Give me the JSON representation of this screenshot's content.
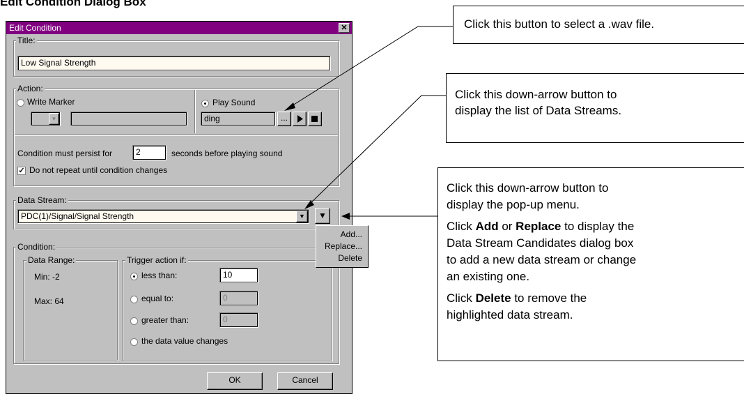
{
  "doc_heading": "Edit Condition Dialog Box",
  "dialog": {
    "title": "Edit Condition",
    "close_glyph": "✕",
    "title_group": {
      "label": "Title:",
      "value": "Low Signal Strength"
    },
    "action_group": {
      "label": "Action:",
      "write_marker_label": "Write Marker",
      "play_sound_label": "Play Sound",
      "sound_value": "ding",
      "browse_label": "...",
      "play_icon": "play-icon",
      "stop_icon": "stop-icon"
    },
    "persist_prefix": "Condition must persist for",
    "persist_value": "2",
    "persist_suffix": "seconds before playing sound",
    "repeat_label": "Do not repeat until condition changes",
    "repeat_checked": true,
    "data_stream_group": {
      "label": "Data Stream:",
      "value": "PDC(1)/Signal/Signal Strength"
    },
    "popup_menu": [
      "Add...",
      "Replace...",
      "Delete"
    ],
    "condition_group": {
      "label": "Condition:",
      "data_range_label": "Data Range:",
      "min_text": "Min: -2",
      "max_text": "Max: 64",
      "trigger_label": "Trigger action if:",
      "options": [
        {
          "label": "less than:",
          "value": "10",
          "selected": true
        },
        {
          "label": "equal to:",
          "value": "0",
          "selected": false
        },
        {
          "label": "greater than:",
          "value": "0",
          "selected": false
        },
        {
          "label": "the data value changes",
          "selected": false
        }
      ]
    },
    "ok_label": "OK",
    "cancel_label": "Cancel"
  },
  "callouts": {
    "wav": "Click this button to select a .wav file.",
    "streams_line1": "Click this down-arrow button to",
    "streams_line2": "display the list of Data Streams.",
    "popup_line1": "Click this down-arrow button to",
    "popup_line2": "display the pop-up menu.",
    "add_prefix": "Click ",
    "add_bold": "Add",
    "add_or": " or ",
    "replace_bold": "Replace",
    "add_suffix_1": " to display the",
    "add_line2": "Data Stream Candidates dialog box",
    "add_line3": "to add a new data stream or change",
    "add_line4": "an existing one.",
    "delete_prefix": "Click ",
    "delete_bold": "Delete",
    "delete_suffix": " to remove the",
    "delete_line2": "highlighted data stream."
  },
  "colors": {
    "titlebar": "#800080",
    "dialog": "#c0c0c0",
    "field_cream": "#fffaf0"
  }
}
